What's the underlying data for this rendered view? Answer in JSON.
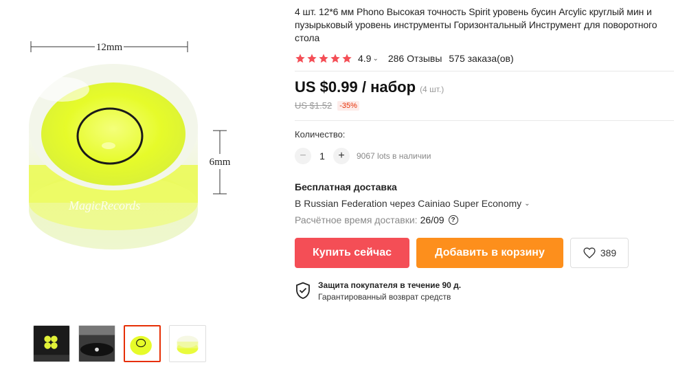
{
  "product": {
    "title": "4 шт. 12*6 мм Phono Высокая точность Spirit уровень бусин Arcylic круглый мин и пузырьковый уровень инструменты Горизонтальный Инструмент для поворотного стола",
    "image_labels": {
      "width": "12mm",
      "height": "6mm",
      "watermark": "MagicRecords"
    }
  },
  "rating": {
    "stars": 5,
    "value": "4.9",
    "reviews": "286 Отзывы",
    "orders": "575 заказа(ов)"
  },
  "price": {
    "current": "US $0.99 / набор",
    "unit_note": "(4 шт.)",
    "old": "US $1.52",
    "discount": "-35%"
  },
  "quantity": {
    "label": "Количество:",
    "minus": "−",
    "value": "1",
    "plus": "+",
    "stock": "9067 lots в наличии"
  },
  "shipping": {
    "title": "Бесплатная доставка",
    "route": "В Russian Federation через Cainiao Super Economy",
    "eta_label": "Расчётное время доставки:",
    "eta_date": "26/09",
    "help": "?"
  },
  "actions": {
    "buy_now": "Купить сейчас",
    "add_to_cart": "Добавить в корзину",
    "wishlist_count": "389"
  },
  "protection": {
    "title": "Защита покупателя в течение 90 д.",
    "subtitle": "Гарантированный возврат средств"
  },
  "icons": {
    "star": "star-icon",
    "chevron": "chevron-down-icon",
    "heart": "heart-icon",
    "shield": "shield-check-icon",
    "help": "question-icon"
  },
  "colors": {
    "star": "#f44e56",
    "buy_now": "#f44e56",
    "add_to_cart": "#fd8f1c",
    "discount": "#e62e04",
    "thumb_active": "#e62e04"
  }
}
